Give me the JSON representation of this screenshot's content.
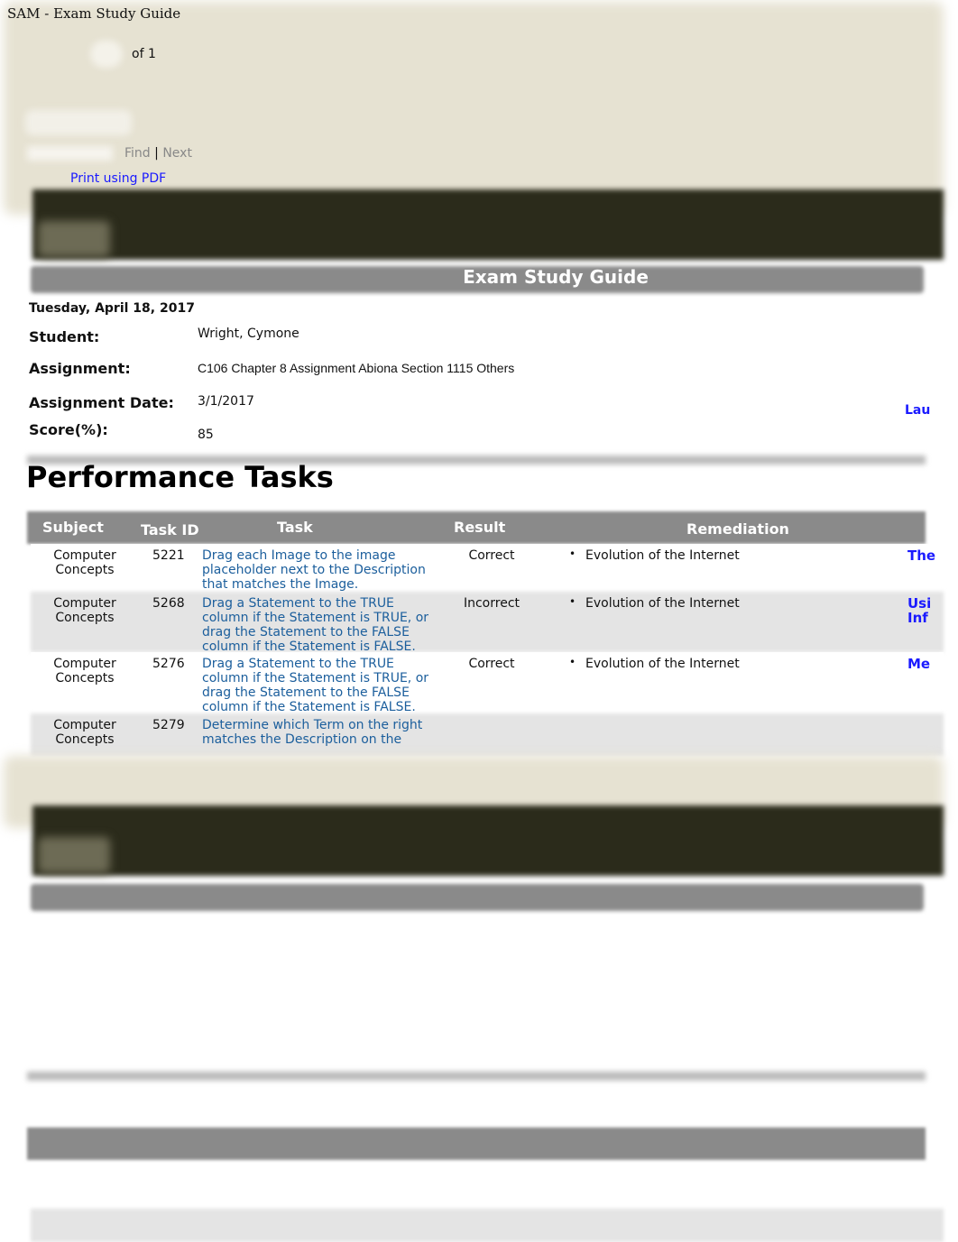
{
  "window_title": "SAM - Exam Study Guide",
  "toolbar": {
    "page_of": "of 1",
    "find": "Find",
    "separator": "|",
    "next": "Next",
    "print_link": "Print using PDF"
  },
  "header": {
    "title": "Exam Study Guide",
    "date": "Tuesday, April 18, 2017"
  },
  "info": {
    "student_label": "Student:",
    "student": "Wright, Cymone",
    "assignment_label": "Assignment:",
    "assignment": "C106 Chapter 8 Assignment Abiona Section 1115 Others",
    "assignment_date_label": "Assignment Date:",
    "assignment_date": "3/1/2017",
    "score_label": "Score(%):",
    "score": "85",
    "side_link": "Lau"
  },
  "section_title": "Performance Tasks",
  "table": {
    "headers": [
      "Subject",
      "Task ID",
      "Task",
      "Result",
      "Remediation"
    ],
    "rows": [
      {
        "subject": "Computer Concepts",
        "id": "5221",
        "task": "Drag each Image to the image placeholder next to the Description that matches the Image.",
        "result": "Correct",
        "remediation": "Evolution of the Internet",
        "link": "The"
      },
      {
        "subject": "Computer Concepts",
        "id": "5268",
        "task": "Drag a Statement to the TRUE column if the Statement is TRUE, or drag the Statement to the FALSE column if the Statement is FALSE.",
        "result": "Incorrect",
        "remediation": "Evolution of the Internet",
        "link": "Usi Inf"
      },
      {
        "subject": "Computer Concepts",
        "id": "5276",
        "task": "Drag a Statement to the TRUE column if the Statement is TRUE, or drag the Statement to the FALSE column if the Statement is FALSE.",
        "result": "Correct",
        "remediation": "Evolution of the Internet",
        "link": "Me"
      },
      {
        "subject": "Computer Concepts",
        "id": "5279",
        "task": "Determine which Term on the right matches the Description on the",
        "result": "",
        "remediation": "",
        "link": ""
      }
    ]
  }
}
